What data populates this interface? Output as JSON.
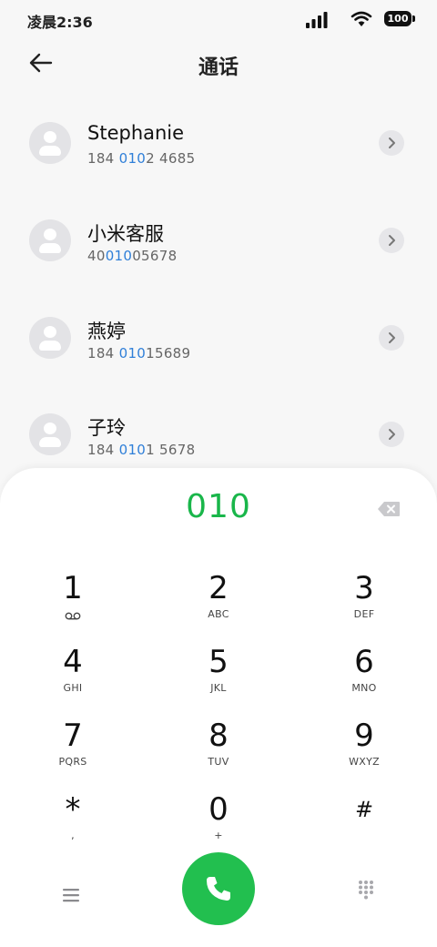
{
  "status_bar": {
    "time": "凌晨2:36",
    "battery": "100",
    "icons": [
      "signal-icon",
      "wifi-icon",
      "battery-icon"
    ]
  },
  "header": {
    "title": "通话",
    "back_icon": "back-arrow-icon"
  },
  "contacts": [
    {
      "name": "Stephanie",
      "number_pre": "184 ",
      "number_match": "010",
      "number_post": "2 4685"
    },
    {
      "name": "小米客服",
      "number_pre": "40",
      "number_match": "010",
      "number_post": "05678"
    },
    {
      "name": "燕婷",
      "number_pre": "184 ",
      "number_match": "010",
      "number_post": "15689"
    },
    {
      "name": "子玲",
      "number_pre": "184 ",
      "number_match": "010",
      "number_post": "1 5678"
    }
  ],
  "dialer": {
    "input": "010",
    "keys": [
      {
        "digit": "1",
        "letters": ""
      },
      {
        "digit": "2",
        "letters": "ABC"
      },
      {
        "digit": "3",
        "letters": "DEF"
      },
      {
        "digit": "4",
        "letters": "GHI"
      },
      {
        "digit": "5",
        "letters": "JKL"
      },
      {
        "digit": "6",
        "letters": "MNO"
      },
      {
        "digit": "7",
        "letters": "PQRS"
      },
      {
        "digit": "8",
        "letters": "TUV"
      },
      {
        "digit": "9",
        "letters": "WXYZ"
      },
      {
        "digit": "*",
        "letters": ","
      },
      {
        "digit": "0",
        "letters": "+"
      },
      {
        "digit": "#",
        "letters": ""
      }
    ]
  },
  "colors": {
    "accent_green": "#22bf4f",
    "match_blue": "#2f7fd8",
    "display_green": "#19b64a"
  }
}
